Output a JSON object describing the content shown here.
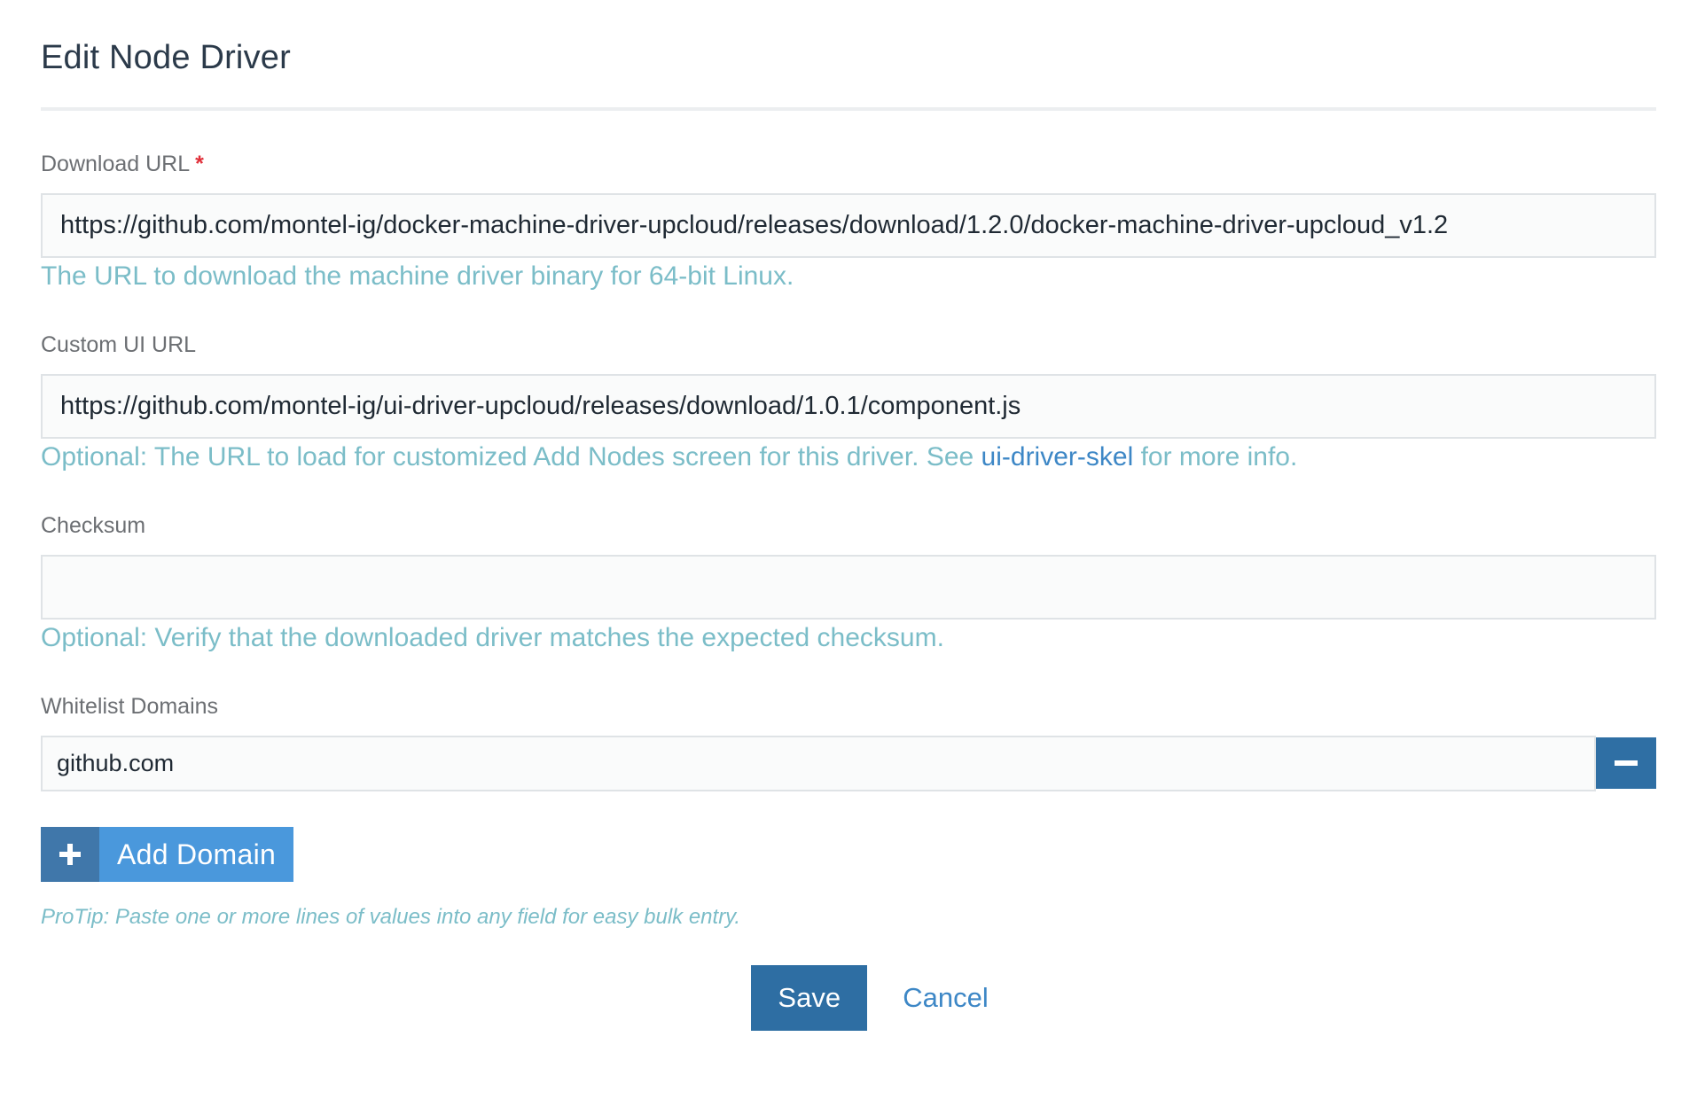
{
  "page": {
    "title": "Edit Node Driver"
  },
  "download_url": {
    "label": "Download URL",
    "required_marker": "*",
    "value": "https://github.com/montel-ig/docker-machine-driver-upcloud/releases/download/1.2.0/docker-machine-driver-upcloud_v1.2",
    "help": "The URL to download the machine driver binary for 64-bit Linux."
  },
  "custom_ui_url": {
    "label": "Custom UI URL",
    "value": "https://github.com/montel-ig/ui-driver-upcloud/releases/download/1.0.1/component.js",
    "help_prefix": "Optional: The URL to load for customized Add Nodes screen for this driver. See ",
    "help_link": "ui-driver-skel",
    "help_suffix": " for more info."
  },
  "checksum": {
    "label": "Checksum",
    "value": "",
    "help": "Optional: Verify that the downloaded driver matches the expected checksum."
  },
  "whitelist": {
    "label": "Whitelist Domains",
    "domains": [
      "github.com"
    ],
    "remove_icon": "minus-icon",
    "add_button_label": "Add Domain",
    "add_icon": "plus-icon",
    "protip": "ProTip: Paste one or more lines of values into any field for easy bulk entry."
  },
  "actions": {
    "save_label": "Save",
    "cancel_label": "Cancel"
  },
  "colors": {
    "primary": "#2e6ea3",
    "add_button": "#4a98dc",
    "help_text": "#7bbdc8",
    "link": "#3d87c6",
    "required": "#e0303a"
  }
}
